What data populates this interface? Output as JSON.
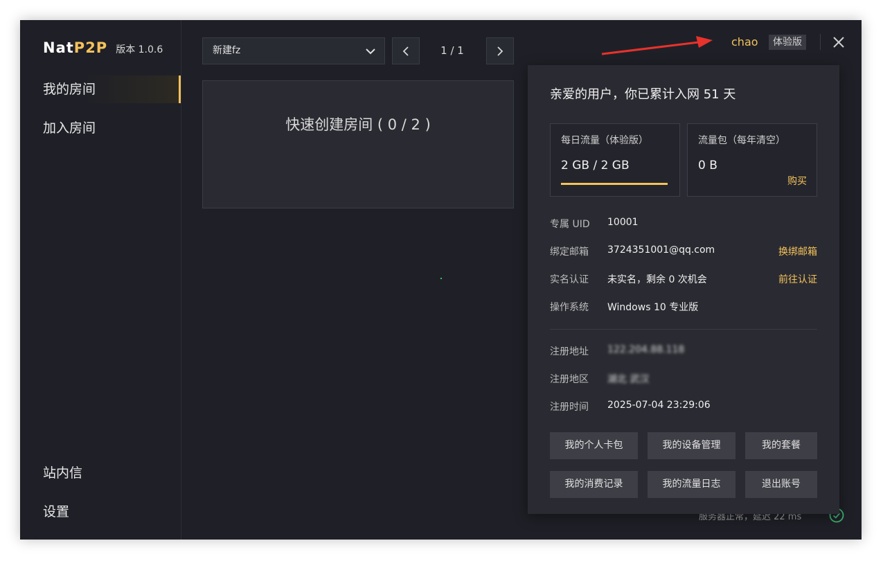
{
  "app": {
    "logo_nat": "Nat",
    "logo_p2p": "P2P",
    "version": "版本 1.0.6"
  },
  "sidebar": {
    "items": [
      {
        "label": "我的房间",
        "active": true
      },
      {
        "label": "加入房间",
        "active": false
      }
    ],
    "bottom_items": [
      {
        "label": "站内信"
      },
      {
        "label": "设置"
      }
    ]
  },
  "toolbar": {
    "select_value": "新建fz",
    "page_indicator": "1 / 1"
  },
  "main": {
    "quick_create": "快速创建房间 ( 0 / 2 )"
  },
  "header": {
    "username": "chao",
    "edition": "体验版"
  },
  "status": {
    "text": "服务器正常，延迟 22 ms"
  },
  "profile": {
    "greeting": "亲爱的用户，你已累计入网 51 天",
    "daily_traffic": {
      "title": "每日流量（体验版）",
      "value": "2 GB / 2 GB",
      "used_fraction": 1.0
    },
    "traffic_pack": {
      "title": "流量包（每年清空）",
      "value": "0 B",
      "buy_label": "购买"
    },
    "rows": {
      "uid": {
        "label": "专属 UID",
        "value": "10001"
      },
      "email": {
        "label": "绑定邮箱",
        "value": "3724351001@qq.com",
        "action": "换绑邮箱"
      },
      "realname": {
        "label": "实名认证",
        "value": "未实名，剩余 0 次机会",
        "action": "前往认证"
      },
      "os": {
        "label": "操作系统",
        "value": "Windows 10 专业版"
      },
      "reg_address": {
        "label": "注册地址",
        "value": "122.204.88.118"
      },
      "reg_region": {
        "label": "注册地区",
        "value": "湖北 武汉"
      },
      "reg_time": {
        "label": "注册时间",
        "value": "2025-07-04 23:29:06"
      }
    },
    "buttons": [
      "我的个人卡包",
      "我的设备管理",
      "我的套餐",
      "我的消费记录",
      "我的流量日志",
      "退出账号"
    ]
  },
  "colors": {
    "accent": "#f5c25b",
    "background": "#1f2027",
    "panel": "#2a2b32",
    "annotation_arrow": "#e8322c",
    "status_ok": "#3cb371"
  },
  "icons": [
    "chevron-down-icon",
    "chevron-left-icon",
    "chevron-right-icon",
    "close-icon",
    "arrow-annotation-icon",
    "check-circle-icon"
  ]
}
